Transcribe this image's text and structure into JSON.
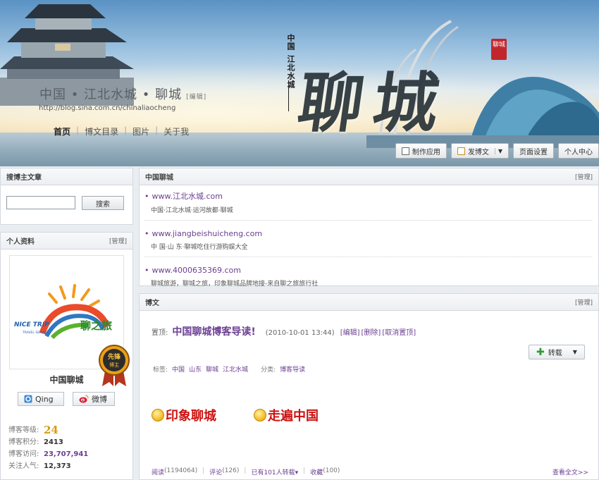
{
  "banner": {
    "title": "中国 • 江北水城 • 聊城",
    "title_edit": "[编辑]",
    "url": "http://blog.sina.com.cn/chinaliaocheng",
    "brush_title": "聊城",
    "vertical_col1": "中国",
    "vertical_col2": "江北水城",
    "seal_text": "聊城",
    "nav": [
      {
        "label": "首页"
      },
      {
        "label": "博文目录"
      },
      {
        "label": "图片"
      },
      {
        "label": "关于我"
      }
    ],
    "toolbar": {
      "make_app": "制作应用",
      "post": "发博文",
      "page_settings": "页面设置",
      "personal_center": "个人中心"
    }
  },
  "sidebar": {
    "search_panel": {
      "title": "搜博主文章",
      "input_value": "",
      "button": "搜索"
    },
    "profile_panel": {
      "title": "个人资料",
      "manage": "[管理]",
      "logo_text_1": "NICE TRIP",
      "logo_text_2": "TRAVEL SERVICE",
      "logo_text_3": "聊之旅",
      "badge_text_1": "先锋",
      "badge_text_2": "博主",
      "name": "中国聊城",
      "qing_button": "Qing",
      "weibo_button": "微博",
      "stats": [
        {
          "label": "博客等级:",
          "value": "24"
        },
        {
          "label": "博客积分:",
          "value": "2413"
        },
        {
          "label": "博客访问:",
          "value": "23,707,941"
        },
        {
          "label": "关注人气:",
          "value": "12,373"
        }
      ]
    }
  },
  "links_panel": {
    "title": "中国聊城",
    "manage": "[管理]",
    "items": [
      {
        "url": "www.江北水城.com",
        "desc": "中国·江北水城·运河故都·聊城"
      },
      {
        "url": "www.jiangbeishuicheng.com",
        "desc": "中 国·山 东·聊城吃住行游购娱大全"
      },
      {
        "url": "www.4000635369.com",
        "desc": "聊城旅游，聊城之旅，印象聊城品牌地接-来自聊之旅旅行社"
      }
    ]
  },
  "posts_panel": {
    "title": "博文",
    "manage": "[管理]",
    "post": {
      "pin_label": "置顶:",
      "title": "中国聊城博客导读!",
      "date": "(2010-10-01 13:44)",
      "edit": "[编辑]",
      "delete": "[删除]",
      "unpin": "[取消置顶]",
      "repost": "转载",
      "tags_label": "标签:",
      "tags": [
        "中国",
        "山东",
        "聊城",
        "江北水城"
      ],
      "category_label": "分类:",
      "category": "博客导读",
      "body_1": "印象聊城",
      "body_2": "走遍中国",
      "read": "阅读",
      "read_count": "(1194064)",
      "comment": "评论",
      "comment_count": "(126)",
      "reposted": "已有101人转载▾",
      "favorite": "收藏",
      "favorite_count": "(100)",
      "read_all": "查看全文>>"
    }
  },
  "colors": {
    "link_purple": "#6b3f92",
    "body_red": "#cc1111",
    "level_gold": "#d89b14"
  }
}
